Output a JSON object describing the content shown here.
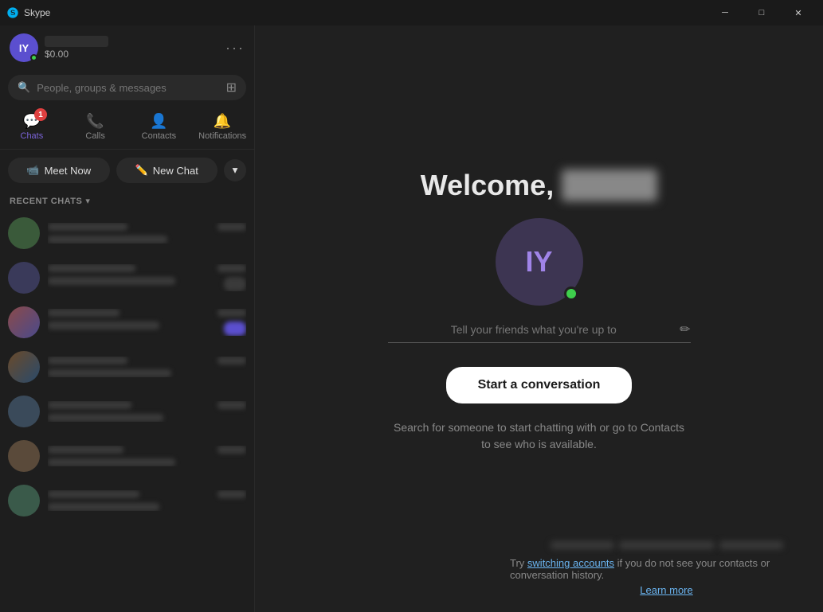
{
  "app": {
    "title": "Skype",
    "titlebar_controls": [
      "minimize",
      "maximize",
      "close"
    ]
  },
  "titlebar": {
    "title": "Skype",
    "minimize_label": "─",
    "maximize_label": "□",
    "close_label": "✕"
  },
  "sidebar": {
    "profile": {
      "initials": "IY",
      "name_blurred": true,
      "credit": "$0.00"
    },
    "search": {
      "placeholder": "People, groups & messages"
    },
    "nav_tabs": [
      {
        "id": "chats",
        "label": "Chats",
        "badge": "1",
        "active": true
      },
      {
        "id": "calls",
        "label": "Calls",
        "badge": null,
        "active": false
      },
      {
        "id": "contacts",
        "label": "Contacts",
        "badge": null,
        "active": false
      },
      {
        "id": "notifications",
        "label": "Notifications",
        "badge": null,
        "active": false
      }
    ],
    "buttons": {
      "meet_now": "Meet Now",
      "new_chat": "New Chat"
    },
    "recent_chats_label": "RECENT CHATS",
    "chat_items": [
      {
        "color": "ci-color-1"
      },
      {
        "color": "ci-color-2"
      },
      {
        "color": "ci-color-3"
      },
      {
        "color": "ci-color-4"
      },
      {
        "color": "ci-color-5"
      },
      {
        "color": "ci-color-6"
      },
      {
        "color": "ci-color-7"
      }
    ]
  },
  "main": {
    "welcome_text": "Welcome,",
    "avatar_initials": "IY",
    "status_placeholder": "Tell your friends what you're up to",
    "start_conversation_label": "Start a conversation",
    "search_hint": "Search for someone to start chatting with or go to Contacts to see who is available.",
    "bottom_text": "Try",
    "switching_accounts_label": "switching accounts",
    "bottom_text2": "if you do not see your contacts or conversation history.",
    "learn_more_label": "Learn more"
  }
}
